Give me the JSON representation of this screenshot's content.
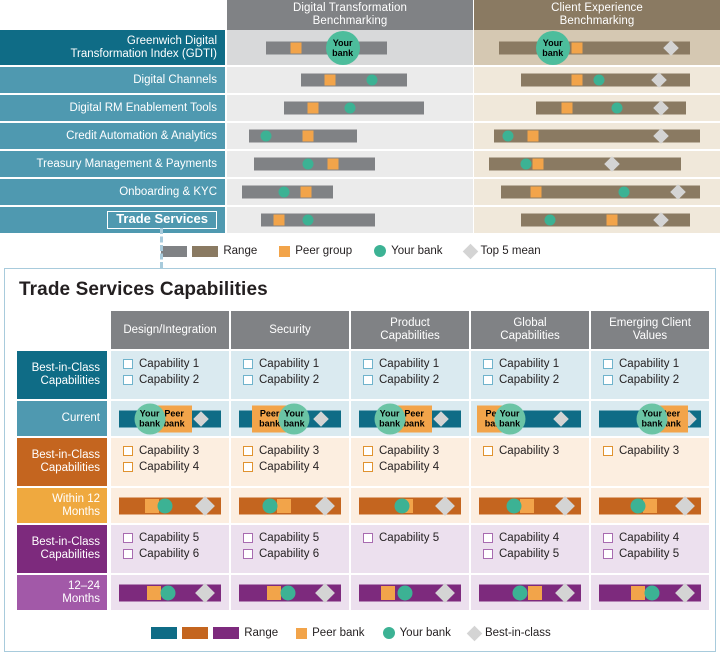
{
  "benchmark": {
    "columns": [
      {
        "id": "dt",
        "label": "Digital Transformation\nBenchmarking",
        "line1": "Digital Transformation",
        "line2": "Benchmarking",
        "header_color": "#808285",
        "cell_color": "#ebebeb",
        "bar_color": "#808285"
      },
      {
        "id": "ce",
        "label": "Client Experience\nBenchmarking",
        "line1": "Client Experience",
        "line2": "Benchmarking",
        "header_color": "#8a7a62",
        "cell_color": "#f0e8da",
        "bar_color": "#8a7a62"
      }
    ],
    "rows": [
      {
        "label": "Greenwich Digital\nTransformation Index (GDTI)",
        "line1": "Greenwich Digital",
        "line2": "Transformation Index (GDTI)",
        "highlight": "gdti",
        "dt": {
          "bar_start": 16,
          "bar_end": 65,
          "peer": 28,
          "your_bank": 47,
          "top5": null
        },
        "ce": {
          "bar_start": 10,
          "bar_end": 88,
          "peer": 42,
          "your_bank": 32,
          "top5": 80
        }
      },
      {
        "label": "Digital Channels",
        "dt": {
          "bar_start": 30,
          "bar_end": 73,
          "peer": 42,
          "your_bank": 59,
          "top5": null
        },
        "ce": {
          "bar_start": 19,
          "bar_end": 88,
          "peer": 42,
          "your_bank": 51,
          "top5": 75
        }
      },
      {
        "label": "Digital RM Enablement Tools",
        "dt": {
          "bar_start": 23,
          "bar_end": 80,
          "peer": 35,
          "your_bank": 50,
          "top5": null
        },
        "ce": {
          "bar_start": 25,
          "bar_end": 86,
          "peer": 38,
          "your_bank": 58,
          "top5": 76
        }
      },
      {
        "label": "Credit Automation & Analytics",
        "dt": {
          "bar_start": 9,
          "bar_end": 53,
          "peer": 33,
          "your_bank": 16,
          "top5": null
        },
        "ce": {
          "bar_start": 8,
          "bar_end": 92,
          "peer": 24,
          "your_bank": 14,
          "top5": 76
        }
      },
      {
        "label": "Treasury Management & Payments",
        "dt": {
          "bar_start": 11,
          "bar_end": 60,
          "peer": 43,
          "your_bank": 33,
          "top5": null
        },
        "ce": {
          "bar_start": 6,
          "bar_end": 84,
          "peer": 26,
          "your_bank": 21,
          "top5": 56
        }
      },
      {
        "label": "Onboarding & KYC",
        "dt": {
          "bar_start": 6,
          "bar_end": 43,
          "peer": 32,
          "your_bank": 23,
          "top5": null
        },
        "ce": {
          "bar_start": 11,
          "bar_end": 92,
          "peer": 25,
          "your_bank": 61,
          "top5": 83
        }
      },
      {
        "label": "Trade Services",
        "boxed": true,
        "dt": {
          "bar_start": 14,
          "bar_end": 60,
          "peer": 21,
          "your_bank": 33,
          "top5": null
        },
        "ce": {
          "bar_start": 19,
          "bar_end": 88,
          "peer": 56,
          "your_bank": 31,
          "top5": 76
        }
      }
    ],
    "legend": {
      "range_label": "Range",
      "peer_label": "Peer group",
      "your_bank_label": "Your bank",
      "top5_label": "Top 5 mean",
      "range_colors": [
        "#808285",
        "#8a7a62"
      ],
      "peer_color": "#f2a44a",
      "your_bank_color": "#3cb294",
      "top5_color": "#d4d4d4"
    }
  },
  "panel": {
    "title": "Trade Services Capabilities",
    "columns": [
      {
        "line1": "Design/Integration",
        "line2": ""
      },
      {
        "line1": "Security",
        "line2": ""
      },
      {
        "line1": "Product",
        "line2": "Capabilities"
      },
      {
        "line1": "Global",
        "line2": "Capabilities"
      },
      {
        "line1": "Emerging Client",
        "line2": "Values"
      }
    ],
    "sections": [
      {
        "id": "current",
        "label_line1": "Best-in-Class",
        "label_line2": "Capabilities",
        "label_color": "#0f6c86",
        "cell_bg": "#daeaf0",
        "checkbox_border": "#6fb3cc",
        "checklists": [
          [
            "Capability 1",
            "Capability 2"
          ],
          [
            "Capability 1",
            "Capability 2"
          ],
          [
            "Capability 1",
            "Capability 2"
          ],
          [
            "Capability 1",
            "Capability 2"
          ],
          [
            "Capability 1",
            "Capability 2"
          ]
        ],
        "bar_label_line1": "Current",
        "bar_label_line2": "",
        "bar_label_color": "#4f99b0",
        "bar_color": "#0f6c86",
        "bars": [
          {
            "your_bank": 30,
            "peer_bank": 54,
            "top5": 80,
            "your_first": true
          },
          {
            "your_bank": 54,
            "peer_bank": 30,
            "top5": 80,
            "your_first": false
          },
          {
            "your_bank": 30,
            "peer_bank": 54,
            "top5": 80,
            "your_first": true
          },
          {
            "your_bank": 30,
            "peer_bank": 16,
            "top5": 80,
            "your_first": false
          },
          {
            "your_bank": 52,
            "peer_bank": 70,
            "top5": 88,
            "your_first": true
          }
        ]
      },
      {
        "id": "within12",
        "label_line1": "Best-in-Class",
        "label_line2": "Capabilities",
        "label_color": "#c4651f",
        "cell_bg": "#fceee0",
        "checkbox_border": "#e0922f",
        "checklists": [
          [
            "Capability 3",
            "Capability 4"
          ],
          [
            "Capability 3",
            "Capability 4"
          ],
          [
            "Capability 3",
            "Capability 4"
          ],
          [
            "Capability 3"
          ],
          [
            "Capability 3"
          ]
        ],
        "bar_label_line1": "Within 12",
        "bar_label_line2": "Months",
        "bar_label_color": "#efa council",
        "bar_color": "#c4651f",
        "bars": [
          {
            "peer": 32,
            "your_bank": 45,
            "top5": 84
          },
          {
            "peer": 44,
            "your_bank": 30,
            "top5": 84
          },
          {
            "peer": 46,
            "your_bank": 42,
            "top5": 84
          },
          {
            "peer": 47,
            "your_bank": 34,
            "top5": 84
          },
          {
            "peer": 50,
            "your_bank": 38,
            "top5": 84
          }
        ]
      },
      {
        "id": "m12to24",
        "label_line1": "Best-in-Class",
        "label_line2": "Capabilities",
        "label_color": "#7d2a7d",
        "cell_bg": "#ece0ee",
        "checkbox_border": "#a86bb0",
        "checklists": [
          [
            "Capability 5",
            "Capability 6"
          ],
          [
            "Capability 5",
            "Capability 6"
          ],
          [
            "Capability 5"
          ],
          [
            "Capability 4",
            "Capability 5"
          ],
          [
            "Capability 4",
            "Capability 5"
          ]
        ],
        "bar_label_line1": "12–24",
        "bar_label_line2": "Months",
        "bar_label_color": "#a259a8",
        "bar_color": "#7d2a7d",
        "bars": [
          {
            "peer": 34,
            "your_bank": 48,
            "top5": 84
          },
          {
            "peer": 34,
            "your_bank": 48,
            "top5": 84
          },
          {
            "peer": 28,
            "your_bank": 45,
            "top5": 84
          },
          {
            "peer": 55,
            "your_bank": 40,
            "top5": 84
          },
          {
            "peer": 38,
            "your_bank": 52,
            "top5": 84
          }
        ]
      }
    ],
    "marker_labels": {
      "your_bank_line1": "Your",
      "your_bank_line2": "bank",
      "peer_bank_line1": "Peer",
      "peer_bank_line2": "bank"
    },
    "legend": {
      "range_label": "Range",
      "peer_label": "Peer bank",
      "your_bank_label": "Your bank",
      "best_label": "Best-in-class",
      "range_colors": [
        "#0f6c86",
        "#c4651f",
        "#7d2a7d"
      ],
      "peer_color": "#f2a44a",
      "your_bank_color": "#3cb294",
      "best_color": "#d4d4d4"
    }
  }
}
